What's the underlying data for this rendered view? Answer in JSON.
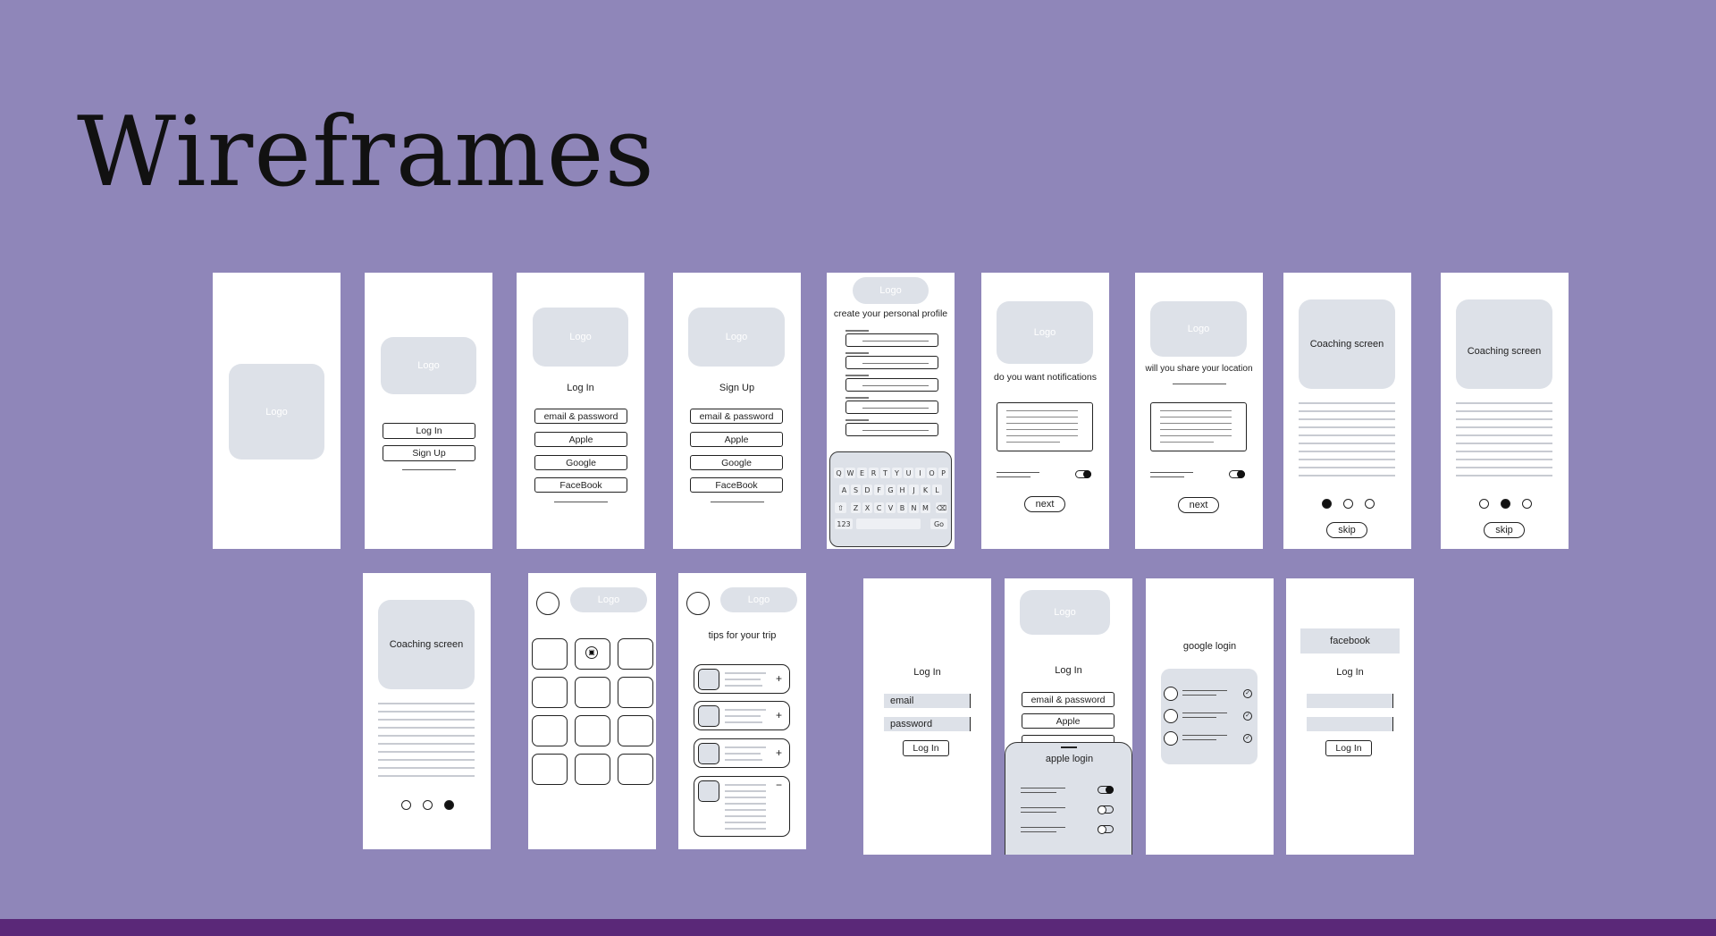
{
  "slide": {
    "title": "Wireframes"
  },
  "colors": {
    "background": "#8f86b9",
    "bottom_bar": "#5a2878",
    "placeholder": "#dde1e8"
  },
  "common": {
    "logo": "Logo",
    "login": "Log In",
    "signup": "Sign Up",
    "next": "next",
    "skip": "skip"
  },
  "providers": {
    "email": "email & password",
    "apple": "Apple",
    "google": "Google",
    "facebook": "FaceBook"
  },
  "profile": {
    "title": "create your personal profile"
  },
  "keyboard": {
    "row1": [
      "Q",
      "W",
      "E",
      "R",
      "T",
      "Y",
      "U",
      "I",
      "O",
      "P"
    ],
    "row2": [
      "A",
      "S",
      "D",
      "F",
      "G",
      "H",
      "J",
      "K",
      "L"
    ],
    "row3": [
      "Z",
      "X",
      "C",
      "V",
      "B",
      "N",
      "M"
    ],
    "shift": "⇧",
    "backspace": "⌫",
    "numbers": "123",
    "go": "Go"
  },
  "notifications": {
    "title": "do you want notifications"
  },
  "location": {
    "title": "will you share your location"
  },
  "coaching": {
    "title": "Coaching screen"
  },
  "tips": {
    "title": "tips for your trip",
    "add": "+",
    "collapse": "−"
  },
  "email_login": {
    "email": "email",
    "password": "password"
  },
  "apple_login": {
    "title": "apple login"
  },
  "google_login": {
    "title": "google login"
  },
  "facebook_login": {
    "header": "facebook"
  }
}
